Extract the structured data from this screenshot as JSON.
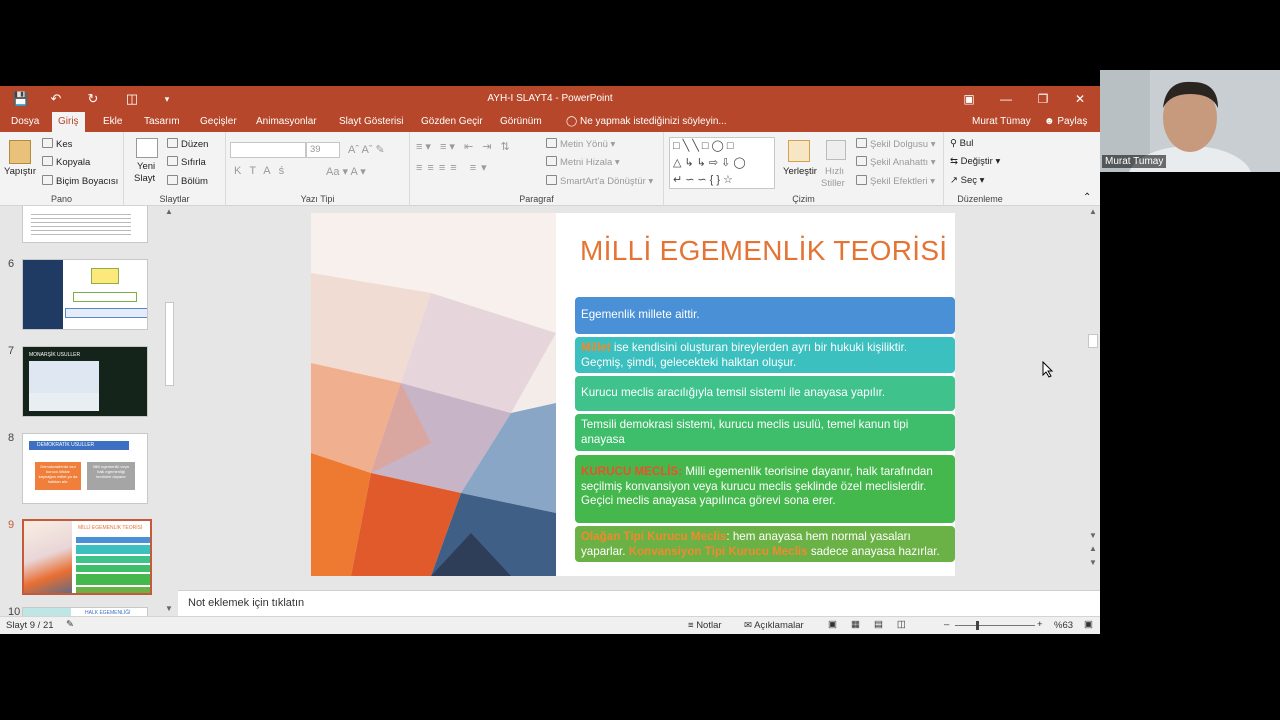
{
  "window": {
    "title": "AYH-I SLAYT4 - PowerPoint"
  },
  "tabs": [
    {
      "label": "Dosya"
    },
    {
      "label": "Giriş"
    },
    {
      "label": "Ekle"
    },
    {
      "label": "Tasarım"
    },
    {
      "label": "Geçişler"
    },
    {
      "label": "Animasyonlar"
    },
    {
      "label": "Slayt Gösterisi"
    },
    {
      "label": "Gözden Geçir"
    },
    {
      "label": "Görünüm"
    }
  ],
  "tellme": "Ne yapmak istediğinizi söyleyin...",
  "user": "Murat Tümay",
  "share": "Paylaş",
  "ribbon": {
    "pano": {
      "paste": "Yapıştır",
      "cut": "Kes",
      "copy": "Kopyala",
      "format_painter": "Biçim Boyacısı",
      "label": "Pano"
    },
    "slaytlar": {
      "new_slide": "Yeni",
      "new_slide2": "Slayt",
      "layout": "Düzen",
      "reset": "Sıfırla",
      "section": "Bölüm",
      "label": "Slaytlar"
    },
    "font": {
      "size": "39",
      "label": "Yazı Tipi"
    },
    "paragraph": {
      "label": "Paragraf",
      "text_dir": "Metin Yönü",
      "align_text": "Metni Hizala",
      "smartart": "SmartArt'a Dönüştür"
    },
    "drawing": {
      "label": "Çizim",
      "arrange": "Yerleştir",
      "quick_styles": "Hızlı",
      "quick_styles2": "Stiller",
      "fill": "Şekil Dolgusu",
      "outline": "Şekil Anahattı",
      "effects": "Şekil Efektleri"
    },
    "editing": {
      "label": "Düzenleme",
      "find": "Bul",
      "replace": "Değiştir",
      "select": "Seç"
    }
  },
  "thumbnails": [
    {
      "num": "6"
    },
    {
      "num": "7",
      "title": "MONARŞİK USULLER"
    },
    {
      "num": "8",
      "title": "DEMOKRATİK USULLER",
      "left": "Demokrasilerde asıl kurucu iktidar kaynağını millet ya da halktan alır.",
      "right": "Milli egemenlik veya halk egemenliği teorisine dayanır"
    },
    {
      "num": "9",
      "title": "MİLLİ EGEMENLİK TEORİSİ"
    },
    {
      "num": "10",
      "title": "HALK EGEMENLİĞİ"
    }
  ],
  "slide": {
    "title": "MİLLİ EGEMENLİK TEORİSİ",
    "b1": "Egemenlik millete aittir.",
    "b2_hl": "Millet",
    "b2": " ise kendisini oluşturan bireylerden ayrı bir hukuki kişiliktir. Geçmiş, şimdi, gelecekteki halktan oluşur.",
    "b3": "Kurucu meclis aracılığıyla temsil sistemi ile anayasa yapılır.",
    "b4": "Temsili demokrasi sistemi, kurucu meclis usulü, temel kanun tipi anayasa",
    "b5_hl": "KURUCU MECLİS:",
    "b5": " Milli egemenlik teorisine dayanır, halk tarafından seçilmiş konvansiyon veya kurucu meclis şeklinde özel meclislerdir. Geçici meclis anayasa yapılınca görevi sona erer.",
    "b6_hl1": "Olağan Tipi Kurucu Meclis",
    "b6_a": ": hem anayasa hem normal yasaları yaparlar. ",
    "b6_hl2": "Konvansiyon Tipi Kurucu Meclis",
    "b6_b": " sadece anayasa hazırlar."
  },
  "notes_placeholder": "Not eklemek için tıklatın",
  "status": {
    "slide": "Slayt 9 / 21",
    "notes": "Notlar",
    "comments": "Açıklamalar",
    "zoom": "%63"
  },
  "webcam": {
    "name": "Murat Tumay"
  },
  "colors": {
    "brand": "#b7472a",
    "title": "#e57434",
    "blue": "#4a90d6",
    "teal": "#3cbfbf",
    "green_teal": "#3fc28c",
    "green": "#3ebd6a",
    "green2": "#45b84d",
    "olive": "#6ab246"
  }
}
